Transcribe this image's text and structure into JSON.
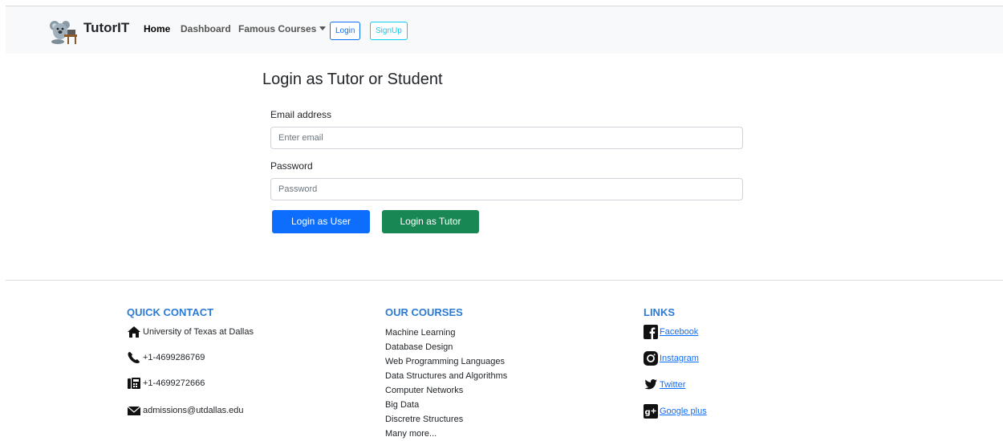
{
  "navbar": {
    "brand": "TutorIT",
    "links": [
      "Home",
      "Dashboard",
      "Famous Courses"
    ],
    "login_button": "Login",
    "signup_button": "SignUp"
  },
  "form": {
    "title": "Login as Tutor or Student",
    "email_label": "Email address",
    "email_placeholder": "Enter email",
    "password_label": "Password",
    "password_placeholder": "Password",
    "login_user_button": "Login as User",
    "login_tutor_button": "Login as Tutor"
  },
  "footer": {
    "contact": {
      "heading": "QUICK CONTACT",
      "address": "University of Texas at Dallas",
      "phone": "+1-4699286769",
      "fax": "+1-4699272666",
      "email": "admissions@utdallas.edu"
    },
    "courses": {
      "heading": "OUR COURSES",
      "items": [
        "Machine Learning",
        "Database Design",
        "Web Programming Languages",
        "Data Structures and Algorithms",
        "Computer Networks",
        "Big Data",
        "Discretre Structures",
        "Many more..."
      ]
    },
    "links": {
      "heading": "LINKS",
      "items": [
        "Facebook",
        "Instagram",
        "Twitter",
        "Google plus"
      ]
    }
  },
  "colors": {
    "primary": "#0d6efd",
    "success": "#198754",
    "info": "#0dcaf0",
    "footer_heading": "#2b7bd6"
  }
}
